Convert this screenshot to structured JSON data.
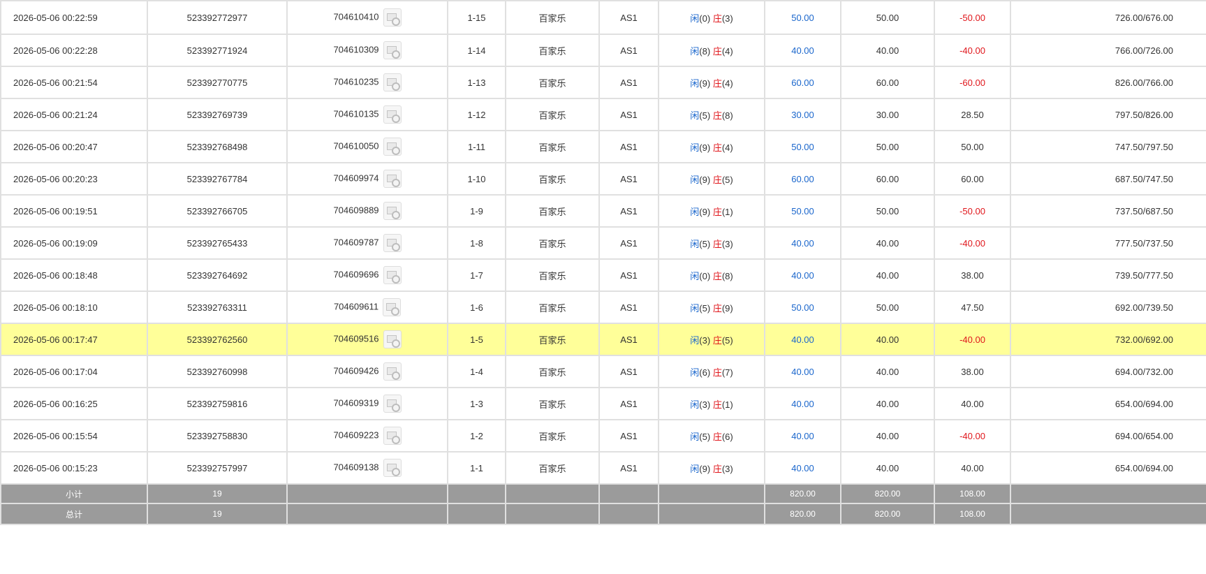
{
  "rows": [
    {
      "time": "2026-05-06 00:22:59",
      "order_id": "523392772977",
      "round_id": "704610410",
      "shoe": "1-15",
      "game": "百家乐",
      "table": "AS1",
      "result": {
        "player_label": "闲",
        "player_points": "(0)",
        "banker_label": "庄",
        "banker_points": "(3)"
      },
      "bet": "50.00",
      "valid_bet": "50.00",
      "win_loss": "-50.00",
      "balance": "726.00/676.00"
    },
    {
      "time": "2026-05-06 00:22:28",
      "order_id": "523392771924",
      "round_id": "704610309",
      "shoe": "1-14",
      "game": "百家乐",
      "table": "AS1",
      "result": {
        "player_label": "闲",
        "player_points": "(8)",
        "banker_label": "庄",
        "banker_points": "(4)"
      },
      "bet": "40.00",
      "valid_bet": "40.00",
      "win_loss": "-40.00",
      "balance": "766.00/726.00"
    },
    {
      "time": "2026-05-06 00:21:54",
      "order_id": "523392770775",
      "round_id": "704610235",
      "shoe": "1-13",
      "game": "百家乐",
      "table": "AS1",
      "result": {
        "player_label": "闲",
        "player_points": "(9)",
        "banker_label": "庄",
        "banker_points": "(4)"
      },
      "bet": "60.00",
      "valid_bet": "60.00",
      "win_loss": "-60.00",
      "balance": "826.00/766.00"
    },
    {
      "time": "2026-05-06 00:21:24",
      "order_id": "523392769739",
      "round_id": "704610135",
      "shoe": "1-12",
      "game": "百家乐",
      "table": "AS1",
      "result": {
        "player_label": "闲",
        "player_points": "(5)",
        "banker_label": "庄",
        "banker_points": "(8)"
      },
      "bet": "30.00",
      "valid_bet": "30.00",
      "win_loss": "28.50",
      "balance": "797.50/826.00"
    },
    {
      "time": "2026-05-06 00:20:47",
      "order_id": "523392768498",
      "round_id": "704610050",
      "shoe": "1-11",
      "game": "百家乐",
      "table": "AS1",
      "result": {
        "player_label": "闲",
        "player_points": "(9)",
        "banker_label": "庄",
        "banker_points": "(4)"
      },
      "bet": "50.00",
      "valid_bet": "50.00",
      "win_loss": "50.00",
      "balance": "747.50/797.50"
    },
    {
      "time": "2026-05-06 00:20:23",
      "order_id": "523392767784",
      "round_id": "704609974",
      "shoe": "1-10",
      "game": "百家乐",
      "table": "AS1",
      "result": {
        "player_label": "闲",
        "player_points": "(9)",
        "banker_label": "庄",
        "banker_points": "(5)"
      },
      "bet": "60.00",
      "valid_bet": "60.00",
      "win_loss": "60.00",
      "balance": "687.50/747.50"
    },
    {
      "time": "2026-05-06 00:19:51",
      "order_id": "523392766705",
      "round_id": "704609889",
      "shoe": "1-9",
      "game": "百家乐",
      "table": "AS1",
      "result": {
        "player_label": "闲",
        "player_points": "(9)",
        "banker_label": "庄",
        "banker_points": "(1)"
      },
      "bet": "50.00",
      "valid_bet": "50.00",
      "win_loss": "-50.00",
      "balance": "737.50/687.50"
    },
    {
      "time": "2026-05-06 00:19:09",
      "order_id": "523392765433",
      "round_id": "704609787",
      "shoe": "1-8",
      "game": "百家乐",
      "table": "AS1",
      "result": {
        "player_label": "闲",
        "player_points": "(5)",
        "banker_label": "庄",
        "banker_points": "(3)"
      },
      "bet": "40.00",
      "valid_bet": "40.00",
      "win_loss": "-40.00",
      "balance": "777.50/737.50"
    },
    {
      "time": "2026-05-06 00:18:48",
      "order_id": "523392764692",
      "round_id": "704609696",
      "shoe": "1-7",
      "game": "百家乐",
      "table": "AS1",
      "result": {
        "player_label": "闲",
        "player_points": "(0)",
        "banker_label": "庄",
        "banker_points": "(8)"
      },
      "bet": "40.00",
      "valid_bet": "40.00",
      "win_loss": "38.00",
      "balance": "739.50/777.50"
    },
    {
      "time": "2026-05-06 00:18:10",
      "order_id": "523392763311",
      "round_id": "704609611",
      "shoe": "1-6",
      "game": "百家乐",
      "table": "AS1",
      "result": {
        "player_label": "闲",
        "player_points": "(5)",
        "banker_label": "庄",
        "banker_points": "(9)"
      },
      "bet": "50.00",
      "valid_bet": "50.00",
      "win_loss": "47.50",
      "balance": "692.00/739.50"
    },
    {
      "time": "2026-05-06 00:17:47",
      "order_id": "523392762560",
      "round_id": "704609516",
      "shoe": "1-5",
      "game": "百家乐",
      "table": "AS1",
      "result": {
        "player_label": "闲",
        "player_points": "(3)",
        "banker_label": "庄",
        "banker_points": "(5)"
      },
      "bet": "40.00",
      "valid_bet": "40.00",
      "win_loss": "-40.00",
      "balance": "732.00/692.00",
      "highlighted": true
    },
    {
      "time": "2026-05-06 00:17:04",
      "order_id": "523392760998",
      "round_id": "704609426",
      "shoe": "1-4",
      "game": "百家乐",
      "table": "AS1",
      "result": {
        "player_label": "闲",
        "player_points": "(6)",
        "banker_label": "庄",
        "banker_points": "(7)"
      },
      "bet": "40.00",
      "valid_bet": "40.00",
      "win_loss": "38.00",
      "balance": "694.00/732.00"
    },
    {
      "time": "2026-05-06 00:16:25",
      "order_id": "523392759816",
      "round_id": "704609319",
      "shoe": "1-3",
      "game": "百家乐",
      "table": "AS1",
      "result": {
        "player_label": "闲",
        "player_points": "(3)",
        "banker_label": "庄",
        "banker_points": "(1)"
      },
      "bet": "40.00",
      "valid_bet": "40.00",
      "win_loss": "40.00",
      "balance": "654.00/694.00"
    },
    {
      "time": "2026-05-06 00:15:54",
      "order_id": "523392758830",
      "round_id": "704609223",
      "shoe": "1-2",
      "game": "百家乐",
      "table": "AS1",
      "result": {
        "player_label": "闲",
        "player_points": "(5)",
        "banker_label": "庄",
        "banker_points": "(6)"
      },
      "bet": "40.00",
      "valid_bet": "40.00",
      "win_loss": "-40.00",
      "balance": "694.00/654.00"
    },
    {
      "time": "2026-05-06 00:15:23",
      "order_id": "523392757997",
      "round_id": "704609138",
      "shoe": "1-1",
      "game": "百家乐",
      "table": "AS1",
      "result": {
        "player_label": "闲",
        "player_points": "(9)",
        "banker_label": "庄",
        "banker_points": "(3)"
      },
      "bet": "40.00",
      "valid_bet": "40.00",
      "win_loss": "40.00",
      "balance": "654.00/694.00"
    }
  ],
  "subtotal": {
    "label": "小计",
    "count": "19",
    "bet": "820.00",
    "valid_bet": "820.00",
    "win_loss": "108.00"
  },
  "total": {
    "label": "总计",
    "count": "19",
    "bet": "820.00",
    "valid_bet": "820.00",
    "win_loss": "108.00"
  },
  "icons": {
    "round_detail": "round-detail-icon"
  },
  "colors": {
    "player": "#1a66cc",
    "banker": "#e0161b",
    "bet": "#1a66cc",
    "loss": "#e0161b",
    "highlight_row": "#ffff99",
    "summary_bg": "#9b9b9b"
  }
}
